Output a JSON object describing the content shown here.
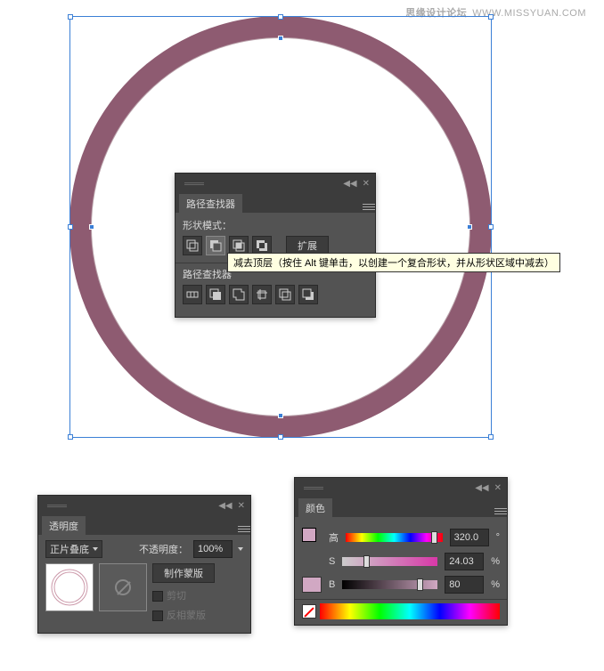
{
  "watermark": {
    "site": "思缘设计论坛",
    "url": "WWW.MISSYUAN.COM"
  },
  "pathfinder": {
    "title": "路径查找器",
    "shape_modes_label": "形状模式：",
    "pathfinders_label": "路径查找器",
    "expand": "扩展",
    "tooltip": "减去顶层（按住 Alt 键单击，以创建一个复合形状，并从形状区域中减去）"
  },
  "transparency": {
    "title": "透明度",
    "blend_mode": "正片叠底",
    "opacity_label": "不透明度：",
    "opacity_value": "100%",
    "make_mask": "制作蒙版",
    "clip": "剪切",
    "invert": "反相蒙版"
  },
  "color": {
    "title": "颜色",
    "h_label": "高",
    "s_label": "S",
    "b_label": "B",
    "h_value": "320.0",
    "s_value": "24.03",
    "b_value": "80",
    "unit_deg": "°",
    "unit_pct": "%",
    "fill": "#d1a8c3",
    "stroke_none": true
  }
}
